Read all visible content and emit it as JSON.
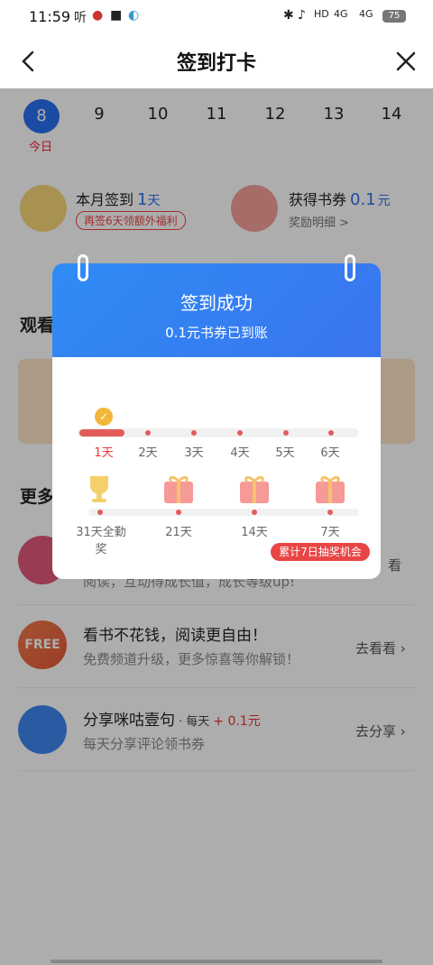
{
  "status": {
    "time": "11:59",
    "signal1": "4G",
    "signal2": "4G",
    "battery": "75"
  },
  "header": {
    "title": "签到打卡"
  },
  "calendar": {
    "days": [
      "8",
      "9",
      "10",
      "11",
      "12",
      "13",
      "14"
    ],
    "today_label": "今日"
  },
  "summary": {
    "month_label": "本月签到",
    "month_count": "1",
    "month_unit": "天",
    "month_tag": "再签6天领额外福利",
    "voucher_label": "获得书券",
    "voucher_value": "0.1",
    "voucher_unit": "元",
    "detail_link": "奖励明细 >"
  },
  "sections": {
    "watch": "观看",
    "more": "更多"
  },
  "tasks": [
    {
      "title": "看书不花钱，阅读更自由！",
      "sub": "免费频道升级，更多惊喜等你解锁！",
      "button": "去看看",
      "icon_text": "FREE"
    },
    {
      "title": "分享咪咕壹句",
      "tag": "· 每天",
      "reward": "+ 0.1元",
      "sub": "每天分享评论领书券",
      "button": "去分享"
    }
  ],
  "partial_row": {
    "sub": "阅读，互动得成长值，成长等级up!",
    "button": "看"
  },
  "modal": {
    "title": "签到成功",
    "subtitle": "0.1元书券已到账",
    "row1": [
      "1天",
      "2天",
      "3天",
      "4天",
      "5天",
      "6天"
    ],
    "row2": [
      "31天全勤奖",
      "21天",
      "14天",
      "7天"
    ],
    "toast": "累计7日抽奖机会"
  },
  "colors": {
    "accent": "#2a6ff0",
    "red": "#e23",
    "header_blue": "#2f8cf5"
  }
}
